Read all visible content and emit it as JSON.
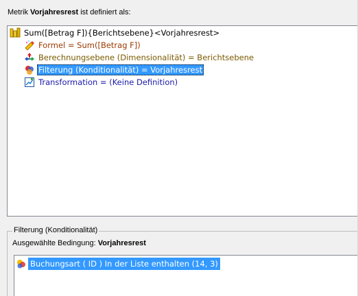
{
  "header": {
    "prefix": "Metrik",
    "metric_name": "Vorjahresrest",
    "suffix": "ist definiert als:"
  },
  "tree": {
    "root_label": "Sum([Betrag F]){Berichtsebene}<Vorjahresrest>",
    "children": [
      {
        "label": "Formel = Sum([Betrag F])",
        "icon": "formula-icon",
        "color": "#9c3a00"
      },
      {
        "label": "Berechnungsebene (Dimensionalität) = Berichtsebene",
        "icon": "level-icon",
        "color": "#7a5a00"
      },
      {
        "label": "Filterung (Konditionalität) = Vorjahresrest",
        "icon": "filter-icon",
        "color": "#ffffff",
        "selected": true
      },
      {
        "label": "Transformation = (Keine Definition)",
        "icon": "transformation-icon",
        "color": "#1a1aa8"
      }
    ]
  },
  "condition_group": {
    "title": "Filterung (Konditionalität)",
    "selected_label": "Ausgewählte Bedingung:",
    "selected_value": "Vorjahresrest",
    "items": [
      {
        "label": "Buchungsart ( ID )  In der Liste enthalten (14, 3)",
        "icon": "condition-icon",
        "selected": true
      }
    ]
  },
  "colors": {
    "selection": "#3399ff",
    "background": "#f0f0f0"
  }
}
